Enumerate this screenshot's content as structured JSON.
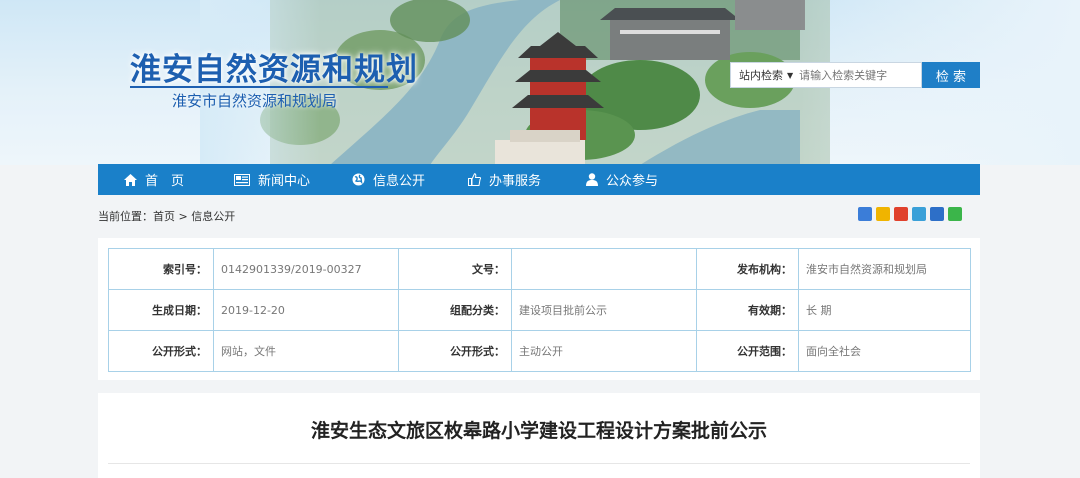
{
  "header": {
    "site_title": "淮安自然资源和规划",
    "site_subtitle": "淮安市自然资源和规划局"
  },
  "search": {
    "scope": "站内检索",
    "placeholder": "请输入检索关键字",
    "button": "检 索"
  },
  "nav": {
    "items": [
      {
        "label": "首　页",
        "icon": "home-icon"
      },
      {
        "label": "新闻中心",
        "icon": "newspaper-icon"
      },
      {
        "label": "信息公开",
        "icon": "globe-icon"
      },
      {
        "label": "办事服务",
        "icon": "thumbs-up-icon"
      },
      {
        "label": "公众参与",
        "icon": "user-icon"
      }
    ]
  },
  "breadcrumb": {
    "text": "当前位置：首页 > 信息公开"
  },
  "share": {
    "icons": [
      "plus-share-icon",
      "qzone-icon",
      "weibo-icon",
      "tencent-weibo-icon",
      "renren-icon",
      "wechat-icon"
    ],
    "colors": [
      "#3b7dd8",
      "#f0b400",
      "#e0412c",
      "#3aa0d8",
      "#2d6fc8",
      "#3bb54a"
    ]
  },
  "info": {
    "rows": [
      [
        {
          "label": "索引号：",
          "value": "0142901339/2019-00327"
        },
        {
          "label": "文号：",
          "value": ""
        },
        {
          "label": "发布机构：",
          "value": "淮安市自然资源和规划局"
        }
      ],
      [
        {
          "label": "生成日期：",
          "value": "2019-12-20"
        },
        {
          "label": "组配分类：",
          "value": "建设项目批前公示"
        },
        {
          "label": "有效期：",
          "value": "长 期"
        }
      ],
      [
        {
          "label": "公开形式：",
          "value": "网站，文件"
        },
        {
          "label": "公开形式：",
          "value": "主动公开"
        },
        {
          "label": "公开范围：",
          "value": "面向全社会"
        }
      ]
    ]
  },
  "article": {
    "title": "淮安生态文旅区枚皋路小学建设工程设计方案批前公示"
  },
  "colors": {
    "primary": "#1a80c9",
    "brand_text": "#1d5fb0",
    "table_border": "#a8d1e8"
  }
}
